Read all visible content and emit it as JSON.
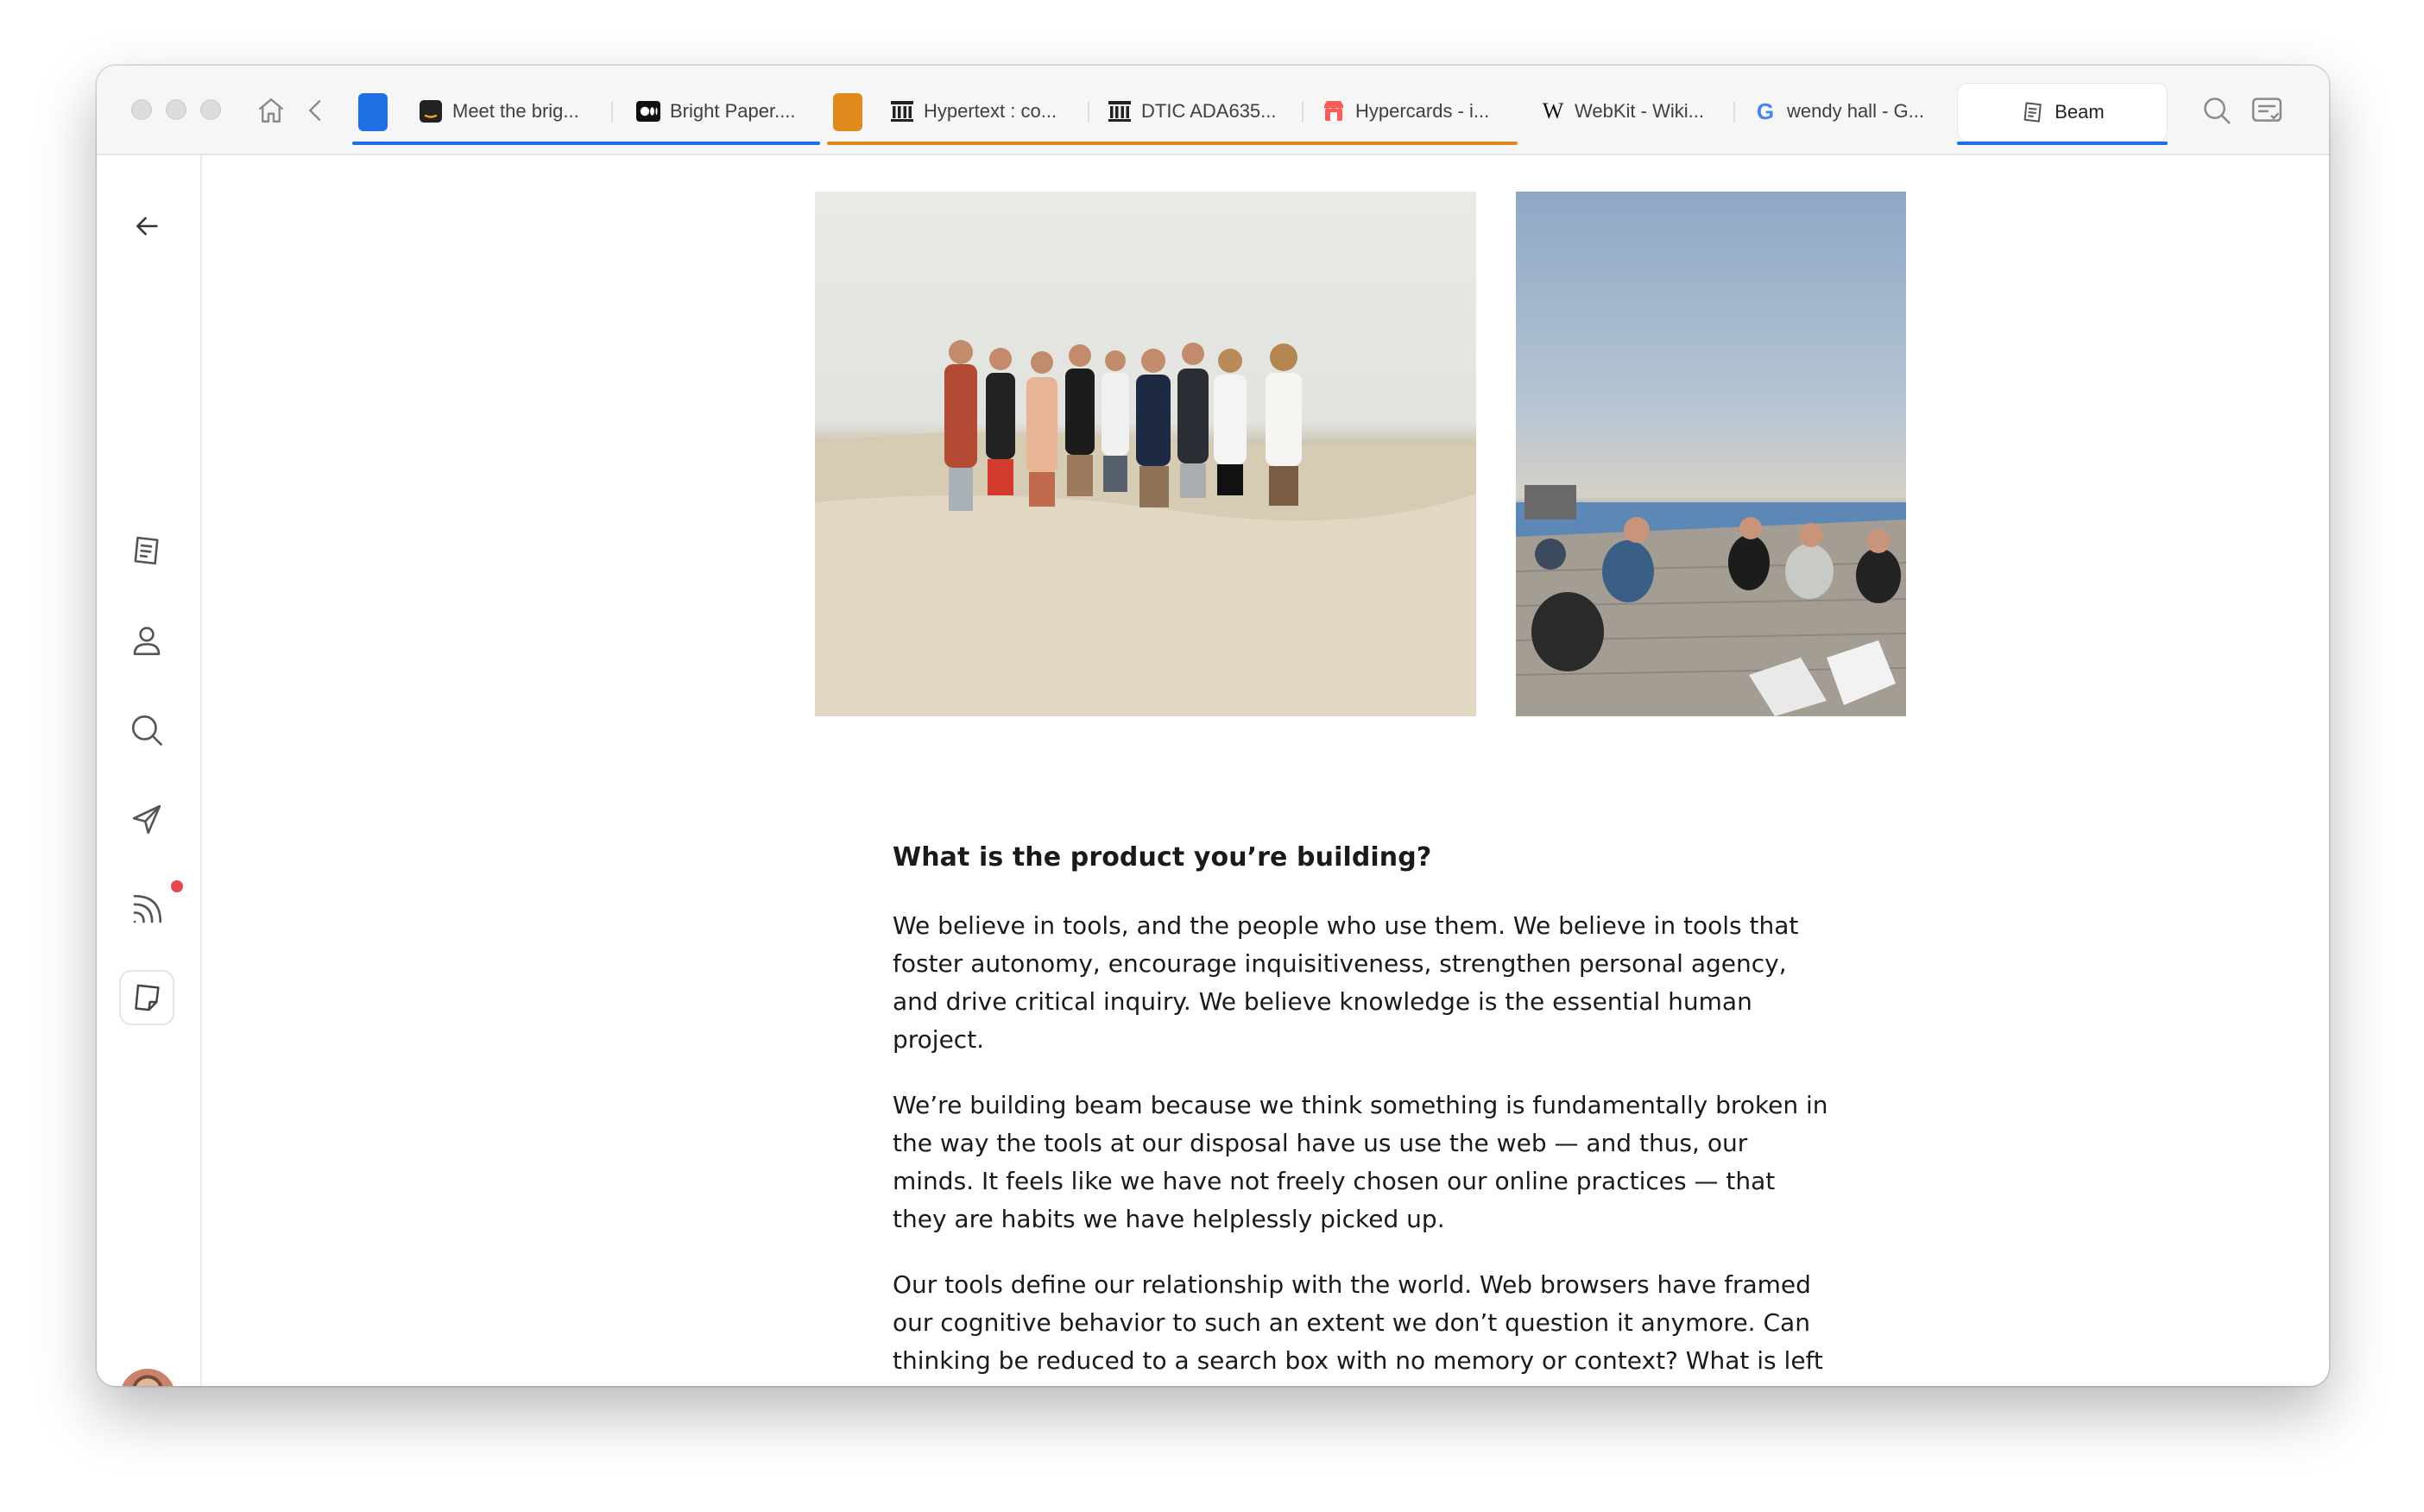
{
  "tabs": [
    {
      "label": "Meet the brig...",
      "favicon": "amazon-icon"
    },
    {
      "label": "Bright Paper....",
      "favicon": "medium-icon"
    },
    {
      "label": "Hypertext : co...",
      "favicon": "archive-icon"
    },
    {
      "label": "DTIC ADA635...",
      "favicon": "archive-icon"
    },
    {
      "label": "Hypercards - i...",
      "favicon": "itch-icon"
    },
    {
      "label": "WebKit - Wiki...",
      "favicon": "wikipedia-icon"
    },
    {
      "label": "wendy hall - G...",
      "favicon": "google-icon"
    }
  ],
  "active_tab": {
    "label": "Beam",
    "favicon": "note-icon"
  },
  "colors": {
    "group_blue": "#1f6fe5",
    "group_orange": "#e08a1e",
    "notification": "#e5484d"
  },
  "article": {
    "heading": "What is the product you’re building?",
    "paragraphs": [
      "We believe in tools, and the people who use them. We believe in tools that foster autonomy, encourage inquisitiveness, strengthen personal agency, and drive critical inquiry. We believe knowledge is the essential human project.",
      "We’re building beam because we think something is fundamentally broken in the way the tools at our disposal have us use the web — and thus, our minds. It feels like we have not freely chosen our online practices — that they are habits we have helplessly picked up.",
      "Our tools define our relationship with the world. Web browsers have framed our cognitive behavior to such an extent we don’t question it anymore. Can thinking be reduced to a search box with no memory or context? What is left of the thousands hours you spent on the web..."
    ]
  }
}
